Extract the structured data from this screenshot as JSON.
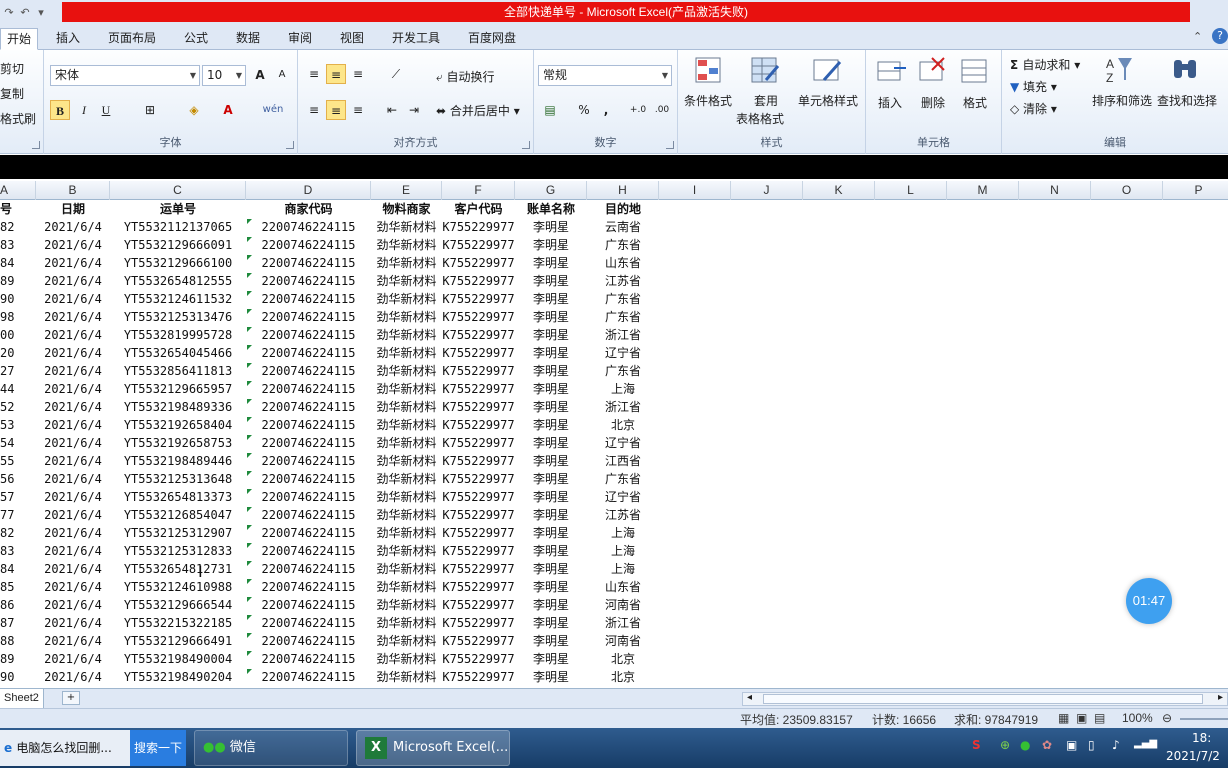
{
  "window": {
    "title": "全部快递单号 - Microsoft Excel(产品激活失败)"
  },
  "tabs": [
    "开始",
    "插入",
    "页面布局",
    "公式",
    "数据",
    "审阅",
    "视图",
    "开发工具",
    "百度网盘"
  ],
  "clipboard": {
    "cut": "剪切",
    "copy": "复制",
    "format_painter": "格式刷"
  },
  "font": {
    "name": "宋体",
    "size": "10",
    "group_label": "字体",
    "bold": "B",
    "italic": "I",
    "underline": "U",
    "grow": "A",
    "shrink": "A",
    "color_letter": "A",
    "phonetic": "wén"
  },
  "alignment": {
    "wrap": "自动换行",
    "merge": "合并后居中",
    "group_label": "对齐方式"
  },
  "number": {
    "format": "常规",
    "percent": "%",
    "comma": ",",
    "inc": "+.0",
    "dec": ".00",
    "group_label": "数字"
  },
  "styles": {
    "conditional": "条件格式",
    "table_line1": "套用",
    "table_line2": "表格格式",
    "cell_styles": "单元格样式",
    "group_label": "样式"
  },
  "cells": {
    "insert": "插入",
    "delete": "删除",
    "format": "格式",
    "group_label": "单元格"
  },
  "editing": {
    "autosum": "自动求和",
    "fill": "填充",
    "clear": "清除",
    "sort": "排序和筛选",
    "find": "查找和选择",
    "group_label": "编辑"
  },
  "columns": [
    "A",
    "B",
    "C",
    "D",
    "E",
    "F",
    "G",
    "H",
    "I",
    "J",
    "K",
    "L",
    "M",
    "N",
    "O",
    "P"
  ],
  "table": {
    "headers": [
      "号",
      "日期",
      "运单号",
      "商家代码",
      "物料商家",
      "客户代码",
      "账单名称",
      "目的地"
    ],
    "rows": [
      [
        "82",
        "2021/6/4",
        "YT5532112137065",
        "2200746224115",
        "劲华新材料",
        "K755229977",
        "李明星",
        "云南省"
      ],
      [
        "83",
        "2021/6/4",
        "YT5532129666091",
        "2200746224115",
        "劲华新材料",
        "K755229977",
        "李明星",
        "广东省"
      ],
      [
        "84",
        "2021/6/4",
        "YT5532129666100",
        "2200746224115",
        "劲华新材料",
        "K755229977",
        "李明星",
        "山东省"
      ],
      [
        "89",
        "2021/6/4",
        "YT5532654812555",
        "2200746224115",
        "劲华新材料",
        "K755229977",
        "李明星",
        "江苏省"
      ],
      [
        "90",
        "2021/6/4",
        "YT5532124611532",
        "2200746224115",
        "劲华新材料",
        "K755229977",
        "李明星",
        "广东省"
      ],
      [
        "98",
        "2021/6/4",
        "YT5532125313476",
        "2200746224115",
        "劲华新材料",
        "K755229977",
        "李明星",
        "广东省"
      ],
      [
        "00",
        "2021/6/4",
        "YT5532819995728",
        "2200746224115",
        "劲华新材料",
        "K755229977",
        "李明星",
        "浙江省"
      ],
      [
        "20",
        "2021/6/4",
        "YT5532654045466",
        "2200746224115",
        "劲华新材料",
        "K755229977",
        "李明星",
        "辽宁省"
      ],
      [
        "27",
        "2021/6/4",
        "YT5532856411813",
        "2200746224115",
        "劲华新材料",
        "K755229977",
        "李明星",
        "广东省"
      ],
      [
        "44",
        "2021/6/4",
        "YT5532129665957",
        "2200746224115",
        "劲华新材料",
        "K755229977",
        "李明星",
        "上海"
      ],
      [
        "52",
        "2021/6/4",
        "YT5532198489336",
        "2200746224115",
        "劲华新材料",
        "K755229977",
        "李明星",
        "浙江省"
      ],
      [
        "53",
        "2021/6/4",
        "YT5532192658404",
        "2200746224115",
        "劲华新材料",
        "K755229977",
        "李明星",
        "北京"
      ],
      [
        "54",
        "2021/6/4",
        "YT5532192658753",
        "2200746224115",
        "劲华新材料",
        "K755229977",
        "李明星",
        "辽宁省"
      ],
      [
        "55",
        "2021/6/4",
        "YT5532198489446",
        "2200746224115",
        "劲华新材料",
        "K755229977",
        "李明星",
        "江西省"
      ],
      [
        "56",
        "2021/6/4",
        "YT5532125313648",
        "2200746224115",
        "劲华新材料",
        "K755229977",
        "李明星",
        "广东省"
      ],
      [
        "57",
        "2021/6/4",
        "YT5532654813373",
        "2200746224115",
        "劲华新材料",
        "K755229977",
        "李明星",
        "辽宁省"
      ],
      [
        "77",
        "2021/6/4",
        "YT5532126854047",
        "2200746224115",
        "劲华新材料",
        "K755229977",
        "李明星",
        "江苏省"
      ],
      [
        "82",
        "2021/6/4",
        "YT5532125312907",
        "2200746224115",
        "劲华新材料",
        "K755229977",
        "李明星",
        "上海"
      ],
      [
        "83",
        "2021/6/4",
        "YT5532125312833",
        "2200746224115",
        "劲华新材料",
        "K755229977",
        "李明星",
        "上海"
      ],
      [
        "84",
        "2021/6/4",
        "YT5532654812731",
        "2200746224115",
        "劲华新材料",
        "K755229977",
        "李明星",
        "上海"
      ],
      [
        "85",
        "2021/6/4",
        "YT5532124610988",
        "2200746224115",
        "劲华新材料",
        "K755229977",
        "李明星",
        "山东省"
      ],
      [
        "86",
        "2021/6/4",
        "YT5532129666544",
        "2200746224115",
        "劲华新材料",
        "K755229977",
        "李明星",
        "河南省"
      ],
      [
        "87",
        "2021/6/4",
        "YT5532215322185",
        "2200746224115",
        "劲华新材料",
        "K755229977",
        "李明星",
        "浙江省"
      ],
      [
        "88",
        "2021/6/4",
        "YT5532129666491",
        "2200746224115",
        "劲华新材料",
        "K755229977",
        "李明星",
        "河南省"
      ],
      [
        "89",
        "2021/6/4",
        "YT5532198490004",
        "2200746224115",
        "劲华新材料",
        "K755229977",
        "李明星",
        "北京"
      ],
      [
        "90",
        "2021/6/4",
        "YT5532198490204",
        "2200746224115",
        "劲华新材料",
        "K755229977",
        "李明星",
        "北京"
      ]
    ]
  },
  "sheet": {
    "name": "Sheet2"
  },
  "status": {
    "average": "平均值: 23509.83157",
    "count": "计数: 16656",
    "sum": "求和: 97847919",
    "zoom": "100%"
  },
  "timer": "01:47",
  "taskbar": {
    "item1": "电脑怎么找回删...",
    "search": "搜索一下",
    "wechat": "微信",
    "excel": "Microsoft Excel(...",
    "clock_time": "18:",
    "clock_date": "2021/7/2"
  }
}
